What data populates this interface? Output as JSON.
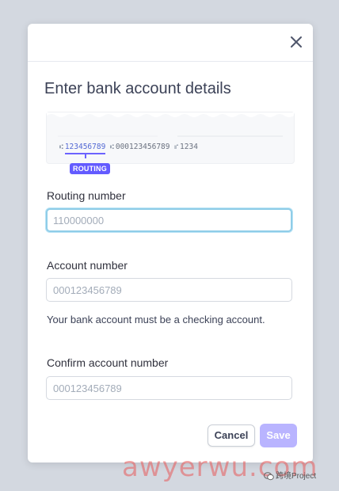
{
  "modal": {
    "title": "Enter bank account details",
    "close_icon": "close-icon"
  },
  "check_preview": {
    "routing_number": "123456789",
    "account_number": "000123456789",
    "check_number": "1234",
    "routing_tag": "ROUTING"
  },
  "fields": {
    "routing": {
      "label": "Routing number",
      "value": "",
      "placeholder": "110000000"
    },
    "account": {
      "label": "Account number",
      "value": "",
      "placeholder": "000123456789",
      "helper": "Your bank account must be a checking account."
    },
    "confirm": {
      "label": "Confirm account number",
      "value": "",
      "placeholder": "000123456789"
    }
  },
  "actions": {
    "cancel_label": "Cancel",
    "save_label": "Save"
  },
  "watermark": {
    "text": "awyerwu.com",
    "badge_text": "跨境Project"
  },
  "colors": {
    "accent": "#635bff",
    "save_disabled": "#b9b4ff",
    "focus_ring": "#8fcde8",
    "backdrop": "#d3d8e0"
  }
}
